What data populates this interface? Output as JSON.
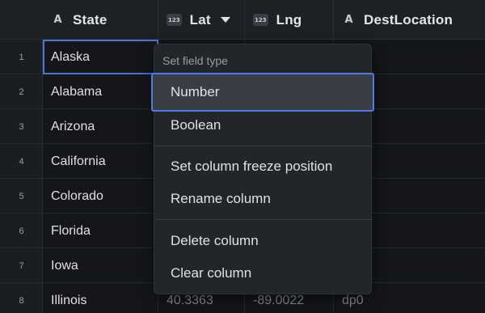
{
  "columns": [
    {
      "name": "State",
      "type_icon": "text-type-icon",
      "type_label": "A"
    },
    {
      "name": "Lat",
      "type_icon": "number-type-icon",
      "type_label": "123"
    },
    {
      "name": "Lng",
      "type_icon": "number-type-icon",
      "type_label": "123"
    },
    {
      "name": "DestLocation",
      "type_icon": "text-type-icon",
      "type_label": "A"
    }
  ],
  "rows": [
    {
      "num": "1",
      "state": "Alaska",
      "lat": "",
      "lng": "",
      "dest": ""
    },
    {
      "num": "2",
      "state": "Alabama",
      "lat": "",
      "lng": "",
      "dest": ""
    },
    {
      "num": "3",
      "state": "Arizona",
      "lat": "",
      "lng": "",
      "dest": ""
    },
    {
      "num": "4",
      "state": "California",
      "lat": "",
      "lng": "",
      "dest": ""
    },
    {
      "num": "5",
      "state": "Colorado",
      "lat": "",
      "lng": "",
      "dest": ""
    },
    {
      "num": "6",
      "state": "Florida",
      "lat": "",
      "lng": "",
      "dest": ""
    },
    {
      "num": "7",
      "state": "Iowa",
      "lat": "",
      "lng": "",
      "dest": ""
    },
    {
      "num": "8",
      "state": "Illinois",
      "lat": "40.3363",
      "lng": "-89.0022",
      "dest": "dp0"
    }
  ],
  "context_menu": {
    "header": "Set field type",
    "items": {
      "number": "Number",
      "boolean": "Boolean",
      "freeze": "Set column freeze position",
      "rename": "Rename column",
      "delete": "Delete column",
      "clear": "Clear column"
    }
  },
  "colors": {
    "accent": "#4a74d6",
    "background": "#141619",
    "menu_bg": "#22252a"
  }
}
